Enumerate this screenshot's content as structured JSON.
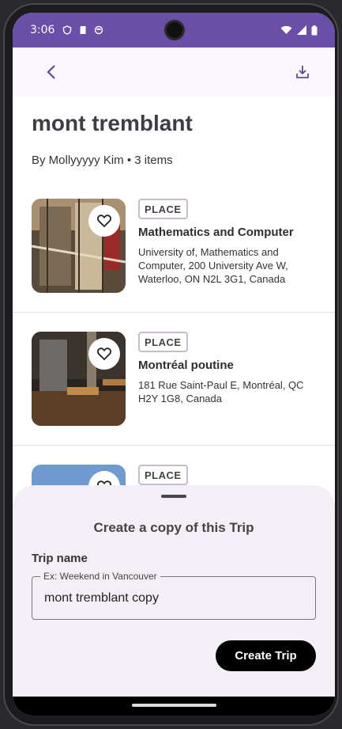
{
  "status_bar": {
    "time": "3:06"
  },
  "trip": {
    "title": "mont tremblant",
    "byline": "By Mollyyyyy Kim • 3 items"
  },
  "items": [
    {
      "badge": "PLACE",
      "name": "Mathematics and Computer",
      "address": "University of, Mathematics and Computer, 200 University Ave W, Waterloo, ON N2L 3G1, Canada"
    },
    {
      "badge": "PLACE",
      "name": "Montréal poutine",
      "address": "181 Rue Saint-Paul E, Montréal, QC H2Y 1G8, Canada"
    },
    {
      "badge": "PLACE"
    }
  ],
  "sheet": {
    "title": "Create a copy of this Trip",
    "field_label": "Trip name",
    "placeholder": "Ex: Weekend in Vancouver",
    "value": "mont tremblant copy",
    "button": "Create Trip"
  },
  "icons": {
    "back": "back-arrow-icon",
    "download": "download-icon",
    "heart": "heart-outline-icon"
  },
  "colors": {
    "status_bar": "#6a4fa8",
    "sheet_bg": "#f4eff6",
    "appbar_bg": "#fbf6fd"
  }
}
